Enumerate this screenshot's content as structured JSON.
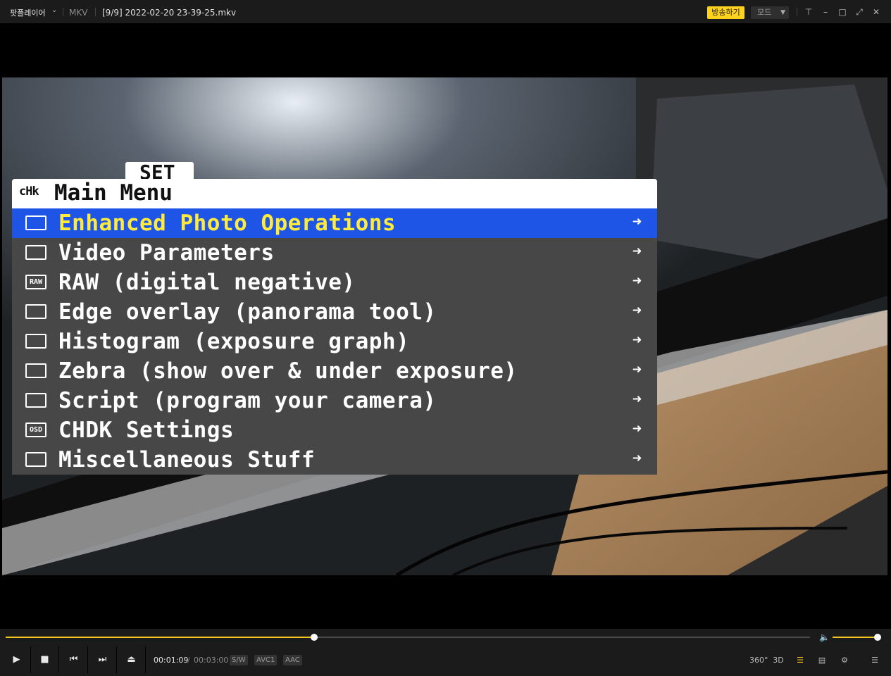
{
  "titlebar": {
    "app_name": "팟플레이어",
    "format": "MKV",
    "filename": "[9/9] 2022-02-20 23-39-25.mkv",
    "broadcast_label": "방송하기",
    "mode_label": "모드",
    "accent_color": "#ffd21e"
  },
  "video": {
    "tab_label": "SET",
    "menu": {
      "logo": "cHk",
      "title": "Main Menu",
      "selected_color": "#1f55e6",
      "selected_text_color": "#ffeb3b",
      "items": [
        {
          "label": "Enhanced Photo Operations",
          "icon": "camera-icon",
          "icon_text": "",
          "selected": true
        },
        {
          "label": "Video Parameters",
          "icon": "video-camera-icon",
          "icon_text": ""
        },
        {
          "label": "RAW (digital negative)",
          "icon": "raw-icon",
          "icon_text": "RAW"
        },
        {
          "label": "Edge overlay (panorama tool)",
          "icon": "edge-overlay-icon",
          "icon_text": ""
        },
        {
          "label": "Histogram (exposure graph)",
          "icon": "histogram-icon",
          "icon_text": ""
        },
        {
          "label": "Zebra (show over & under exposure)",
          "icon": "zebra-icon",
          "icon_text": ""
        },
        {
          "label": "Script (program your camera)",
          "icon": "script-icon",
          "icon_text": ""
        },
        {
          "label": "CHDK Settings",
          "icon": "osd-icon",
          "icon_text": "OSD"
        },
        {
          "label": "Miscellaneous Stuff",
          "icon": "misc-icon",
          "icon_text": ""
        }
      ],
      "arrow": "➜"
    }
  },
  "controls": {
    "progress_fraction": 0.3833,
    "volume_fraction": 1.0,
    "time_current": "00:01:09",
    "time_separator": "/",
    "time_total": "00:03:00",
    "badges": [
      "S/W",
      "AVC1",
      "AAC"
    ],
    "right_icons": [
      {
        "name": "360-icon",
        "text": "360°"
      },
      {
        "name": "3d-icon",
        "text": "3D"
      },
      {
        "name": "playlist-search-icon",
        "text": "☰"
      },
      {
        "name": "chapter-icon",
        "text": "▤"
      },
      {
        "name": "gear-icon",
        "text": "⚙"
      },
      {
        "name": "menu-icon",
        "text": "☰"
      }
    ]
  }
}
